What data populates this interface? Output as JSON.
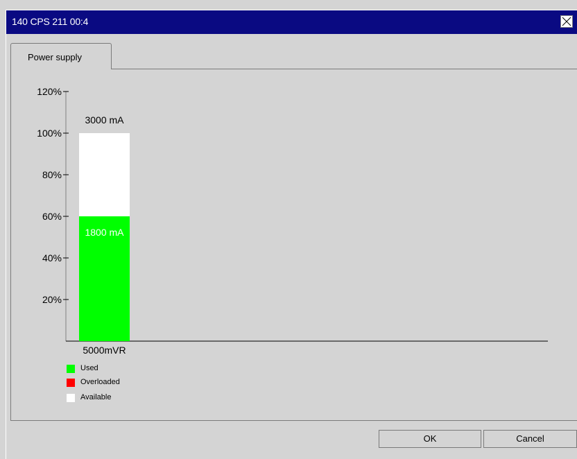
{
  "window": {
    "title": "140 CPS 211 00:4"
  },
  "tabs": [
    {
      "label": "Power supply",
      "active": true
    }
  ],
  "chart_data": {
    "type": "bar",
    "categories": [
      "5000mVR"
    ],
    "series": [
      {
        "name": "Used",
        "values": [
          60
        ],
        "label": "1800 mA",
        "color": "#00ff00"
      },
      {
        "name": "Available",
        "values": [
          40
        ],
        "color": "#ffffff"
      },
      {
        "name": "Overloaded",
        "values": [
          0
        ],
        "color": "#ff0000"
      }
    ],
    "total_label": "3000 mA",
    "yticks": [
      "20%",
      "40%",
      "60%",
      "80%",
      "100%",
      "120%"
    ],
    "ytick_values": [
      20,
      40,
      60,
      80,
      100,
      120
    ],
    "ylim": [
      0,
      120
    ],
    "grid": false,
    "legend_position": "bottom-left"
  },
  "legend": [
    {
      "label": "Used",
      "color": "#00ff00"
    },
    {
      "label": "Overloaded",
      "color": "#ff0000"
    },
    {
      "label": "Available",
      "color": "#ffffff"
    }
  ],
  "buttons": {
    "ok_label": "OK",
    "cancel_label": "Cancel"
  }
}
